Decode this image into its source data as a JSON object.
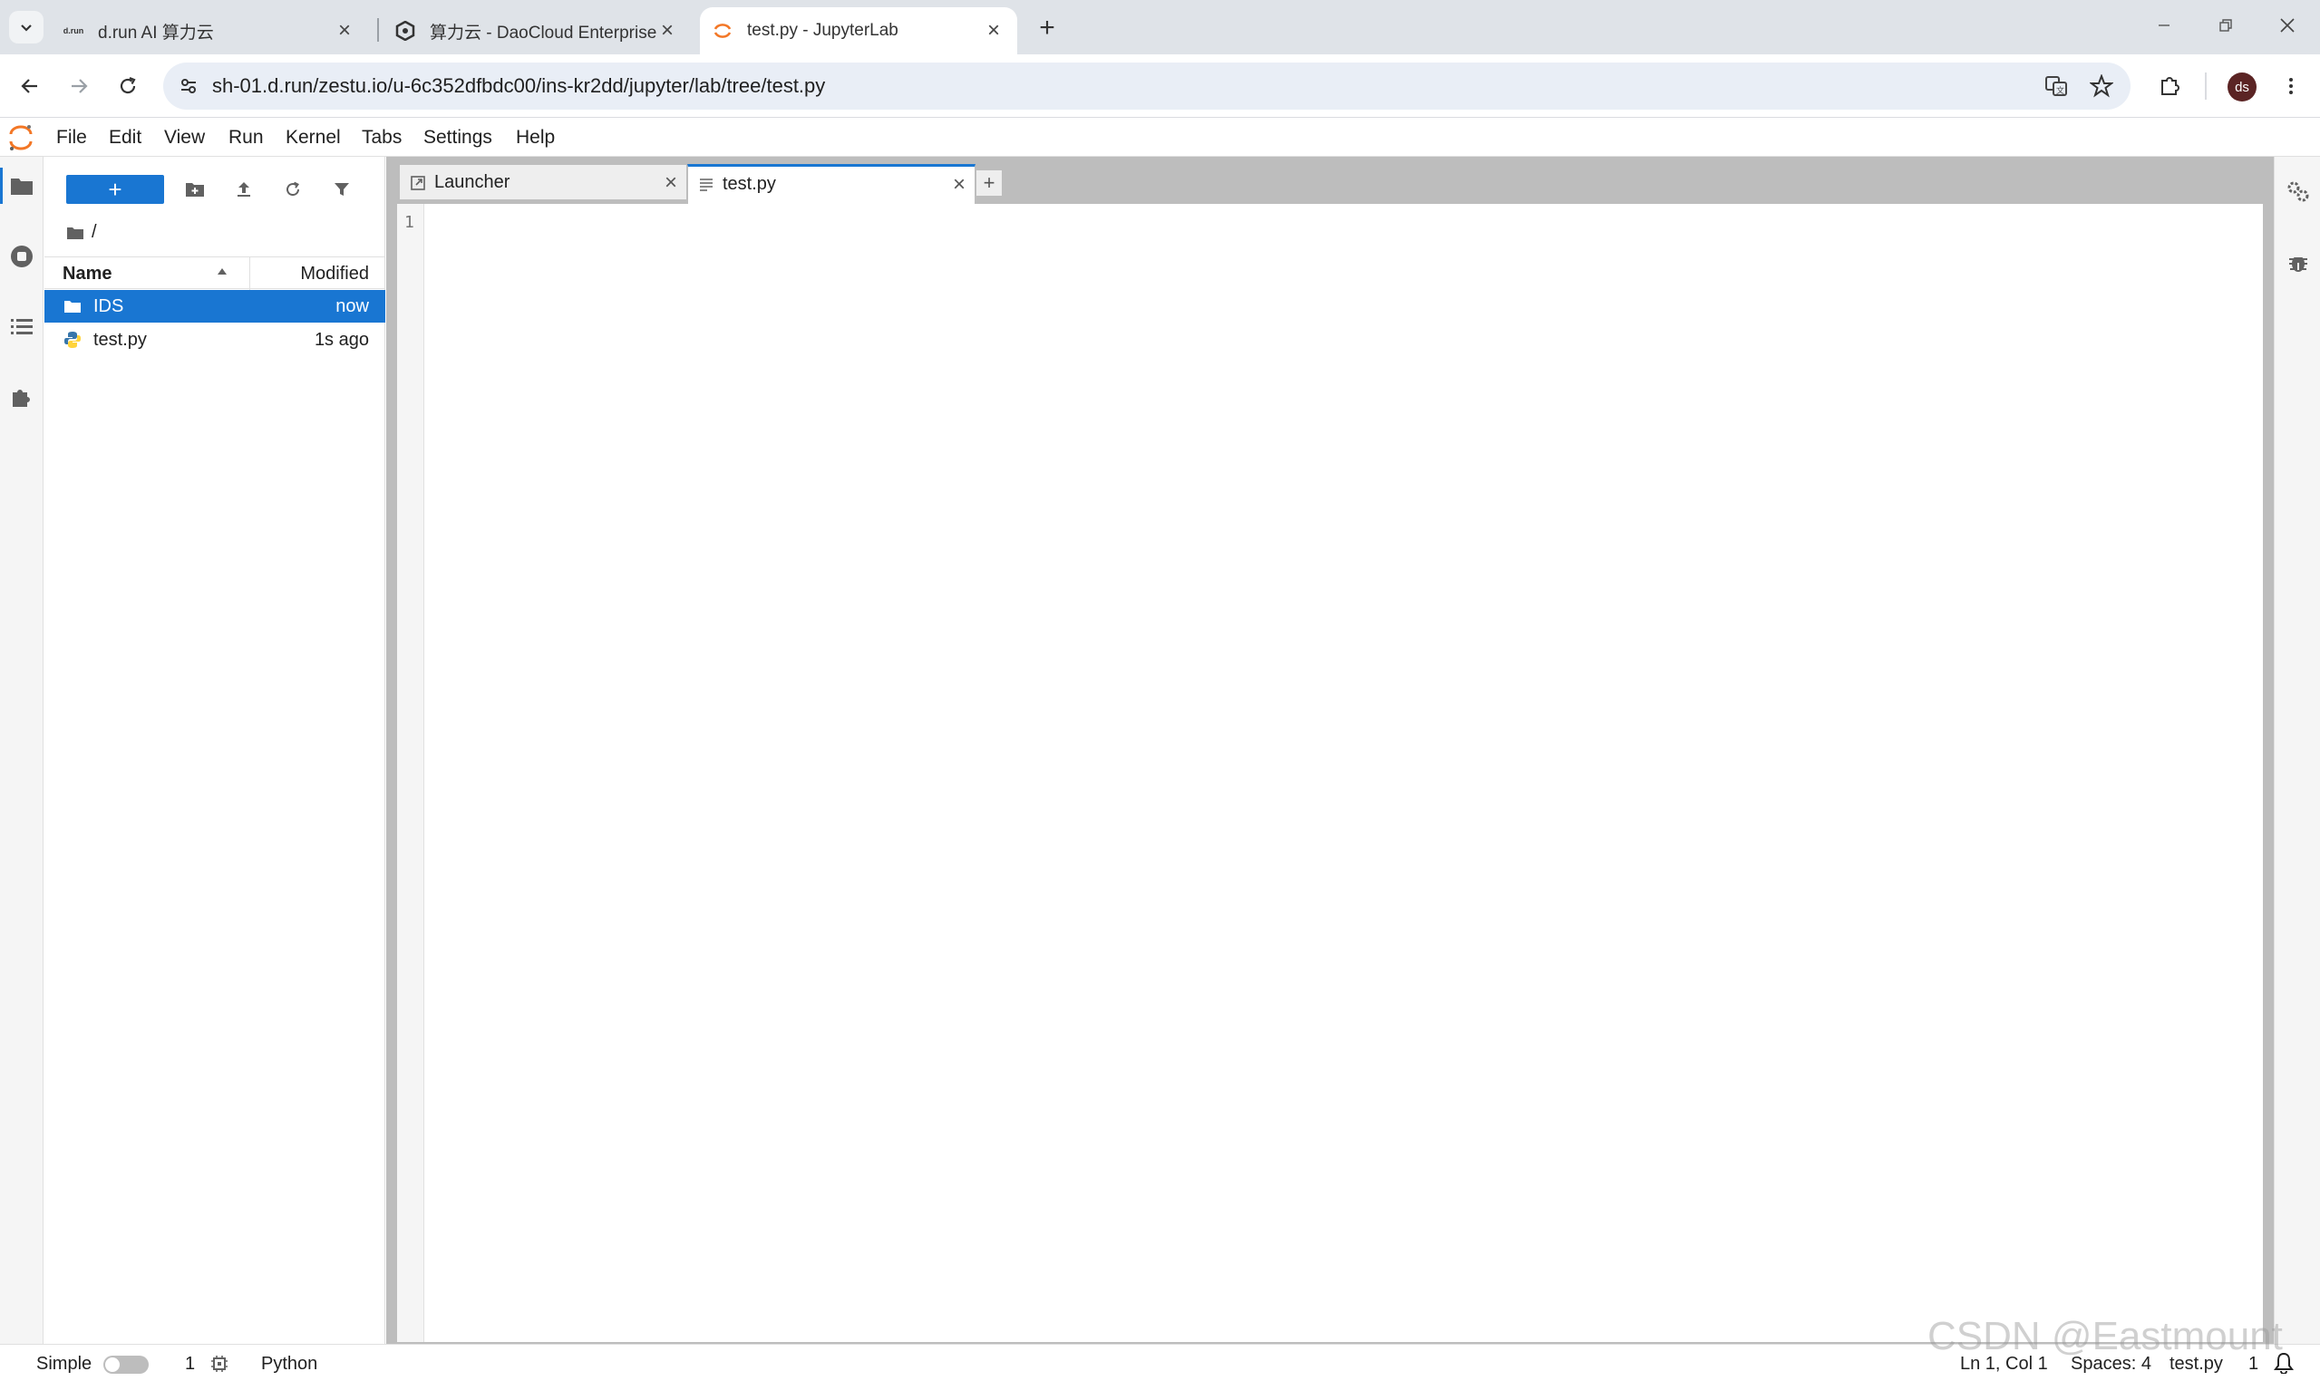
{
  "browser": {
    "tabs": [
      {
        "label": "d.run AI 算力云",
        "favicon": "drun-logo"
      },
      {
        "label": "算力云 - DaoCloud Enterprise",
        "favicon": "daocloud-logo"
      },
      {
        "label": "test.py - JupyterLab",
        "favicon": "jupyter-logo"
      }
    ],
    "favicon_text": "d.run",
    "url": "sh-01.d.run/zestu.io/u-6c352dfbdc00/ins-kr2dd/jupyter/lab/tree/test.py",
    "profile_initials": "ds"
  },
  "jupyter": {
    "menu": [
      "File",
      "Edit",
      "View",
      "Run",
      "Kernel",
      "Tabs",
      "Settings",
      "Help"
    ],
    "filebrowser": {
      "new_button": "+",
      "path": "/",
      "columns": {
        "name": "Name",
        "modified": "Modified"
      },
      "files": [
        {
          "name": "IDS",
          "modified": "now",
          "type": "folder",
          "selected": true
        },
        {
          "name": "test.py",
          "modified": "1s ago",
          "type": "python",
          "selected": false
        }
      ]
    },
    "dock_tabs": [
      {
        "label": "Launcher",
        "close": "×"
      },
      {
        "label": "test.py",
        "close": "×"
      }
    ],
    "add_tab": "+",
    "editor": {
      "line_numbers": [
        "1"
      ]
    },
    "statusbar": {
      "mode": "Simple",
      "kernels": "1",
      "kernel_name": "Python",
      "cursor": "Ln 1, Col 1",
      "spaces": "Spaces: 4",
      "filename": "test.py",
      "notifications": "1"
    }
  },
  "watermark": "CSDN @Eastmount",
  "colors": {
    "accent": "#1976d2",
    "jupyter_orange": "#f37726"
  }
}
